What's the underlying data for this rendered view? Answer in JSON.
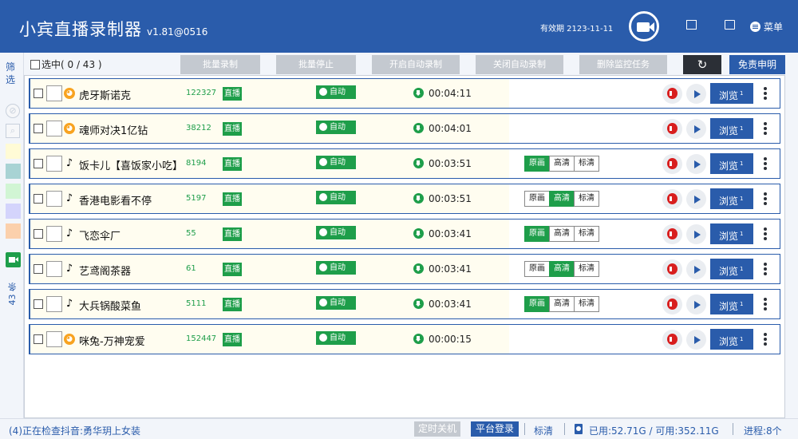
{
  "app": {
    "title": "小宾直播录制器",
    "version": "v1.81@0516",
    "expiry": "有效期 2123-11-11",
    "menu_label": "菜单"
  },
  "sidebar": {
    "filter_label": "筛选",
    "count_label": "43 条",
    "swatch_colors": [
      "#fffbd6",
      "#a8d3d4",
      "#d1f5d4",
      "#d4d4fc",
      "#fbd0ac"
    ]
  },
  "toolbar": {
    "select_all": "选中( 0  /  43 )",
    "batch_record": "批量录制",
    "batch_stop": "批量停止",
    "enable_auto": "开启自动录制",
    "disable_auto": "关闭自动录制",
    "delete_task": "删除监控任务",
    "refresh_icon": "refresh-icon",
    "disclaimer": "免责申明"
  },
  "labels": {
    "live": "直播",
    "auto": "自动",
    "browse": "浏览",
    "browse_badge": "1",
    "q_orig": "原画",
    "q_high": "高清",
    "q_std": "标清"
  },
  "colors": {
    "brand": "#2a5cab",
    "green": "#1e9e4a",
    "red": "#d81e1e"
  },
  "rows": [
    {
      "name": "虎牙斯诺克",
      "platform": "huya",
      "viewers": "122327",
      "duration": "00:04:11",
      "quality": null
    },
    {
      "name": "魂师对决1亿钻",
      "platform": "huya",
      "viewers": "38212",
      "duration": "00:04:01",
      "quality": null
    },
    {
      "name": "饭卡儿【喜饭家小吃】",
      "platform": "douyin",
      "viewers": "8194",
      "duration": "00:03:51",
      "quality": "原画"
    },
    {
      "name": "香港电影看不停",
      "platform": "douyin",
      "viewers": "5197",
      "duration": "00:03:51",
      "quality": "高清"
    },
    {
      "name": "飞恋伞厂",
      "platform": "douyin",
      "viewers": "55",
      "duration": "00:03:41",
      "quality": "原画"
    },
    {
      "name": "艺鸢阁茶器",
      "platform": "douyin",
      "viewers": "61",
      "duration": "00:03:41",
      "quality": "高清"
    },
    {
      "name": "大兵锅酸菜鱼",
      "platform": "douyin",
      "viewers": "5111",
      "duration": "00:03:41",
      "quality": "原画"
    },
    {
      "name": "咪兔-万神宠爱",
      "platform": "huya",
      "viewers": "152447",
      "duration": "00:00:15",
      "quality": null
    }
  ],
  "status": {
    "message": "(4)正在检查抖音:勇华玥上女装",
    "timer_shutdown": "定时关机",
    "platform_login": "平台登录",
    "quality": "标清",
    "disk": "已用:52.71G / 可用:352.11G",
    "process": "进程:8个"
  }
}
